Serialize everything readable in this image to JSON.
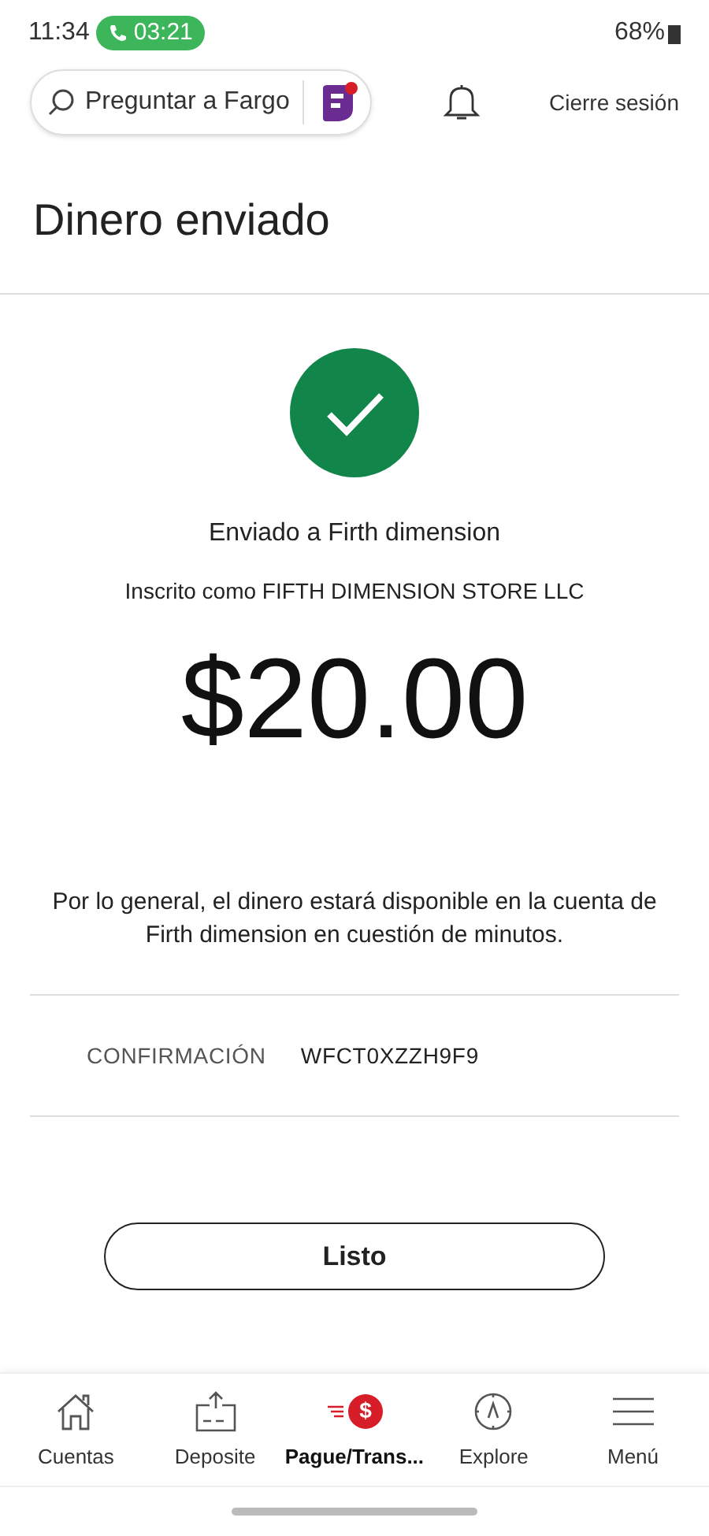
{
  "status_bar": {
    "time": "11:34",
    "call_timer": "03:21",
    "battery": "68%"
  },
  "header": {
    "search_placeholder": "Preguntar a Fargo",
    "logout": "Cierre sesión"
  },
  "title": "Dinero enviado",
  "confirmation": {
    "sent_to": "Enviado a Firth dimension",
    "enrolled_as": "Inscrito como FIFTH DIMENSION STORE LLC",
    "amount": "$20.00",
    "note": "Por lo general, el dinero estará disponible en la cuenta de Firth dimension en cuestión de minutos.",
    "code_label": "CONFIRMACIÓN",
    "code": "WFCT0XZZH9F9"
  },
  "done_button": "Listo",
  "nav": [
    {
      "kind": "home",
      "label": "Cuentas",
      "selected": false
    },
    {
      "kind": "deposit",
      "label": "Deposite",
      "selected": false
    },
    {
      "kind": "pay",
      "label": "Pague/Trans...",
      "badge": "$",
      "selected": true
    },
    {
      "kind": "explore",
      "label": "Explore",
      "selected": false
    },
    {
      "kind": "menu",
      "label": "Menú",
      "selected": false
    }
  ]
}
